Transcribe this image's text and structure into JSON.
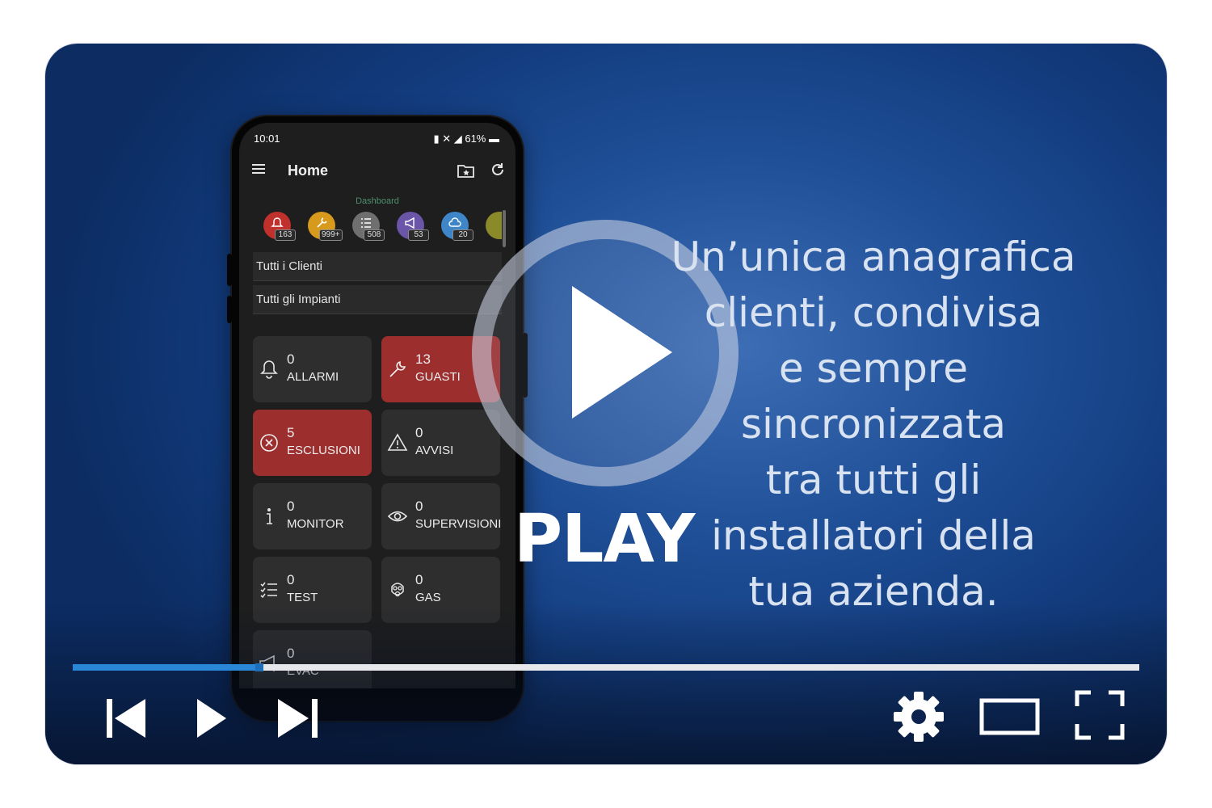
{
  "phone": {
    "status_time": "10:01",
    "status_battery": "61%",
    "app_title": "Home",
    "dashboard_label": "Dashboard",
    "badges": [
      {
        "name": "alarm-bell-icon",
        "count": "163",
        "color": "#c0302c"
      },
      {
        "name": "wrench-icon",
        "count": "999+",
        "color": "#d89a1c"
      },
      {
        "name": "checklist-icon",
        "count": "508",
        "color": "#6f6f6f"
      },
      {
        "name": "megaphone-icon",
        "count": "53",
        "color": "#6a55a8"
      },
      {
        "name": "cloud-icon",
        "count": "20",
        "color": "#3f86c8"
      }
    ],
    "client_select": "Tutti i Clienti",
    "plant_select": "Tutti gli Impianti",
    "tiles": [
      {
        "icon": "bell-icon",
        "count": "0",
        "label": "ALLARMI"
      },
      {
        "icon": "wrench-icon",
        "count": "13",
        "label": "GUASTI"
      },
      {
        "icon": "x-circle-icon",
        "count": "5",
        "label": "ESCLUSIONI"
      },
      {
        "icon": "warning-icon",
        "count": "0",
        "label": "AVVISI"
      },
      {
        "icon": "info-icon",
        "count": "0",
        "label": "MONITOR"
      },
      {
        "icon": "eye-icon",
        "count": "0",
        "label": "SUPERVISIONI"
      },
      {
        "icon": "checklist-icon",
        "count": "0",
        "label": "TEST"
      },
      {
        "icon": "gas-mask-icon",
        "count": "0",
        "label": "GAS"
      },
      {
        "icon": "megaphone-icon",
        "count": "0",
        "label": "EVAC"
      }
    ]
  },
  "overlay": {
    "play_text": "PLAY",
    "tagline_lines": [
      "Un’unica anagrafica",
      "clienti, condivisa",
      "e sempre",
      "sincronizzata",
      "tra tutti gli",
      "installatori della",
      "tua azienda."
    ]
  },
  "player": {
    "progress_fraction": 0.175,
    "accent_color": "#2a86d6",
    "controls": [
      "previous-icon",
      "play-icon",
      "next-icon",
      "settings-gear-icon",
      "theater-mode-icon",
      "fullscreen-icon"
    ]
  }
}
